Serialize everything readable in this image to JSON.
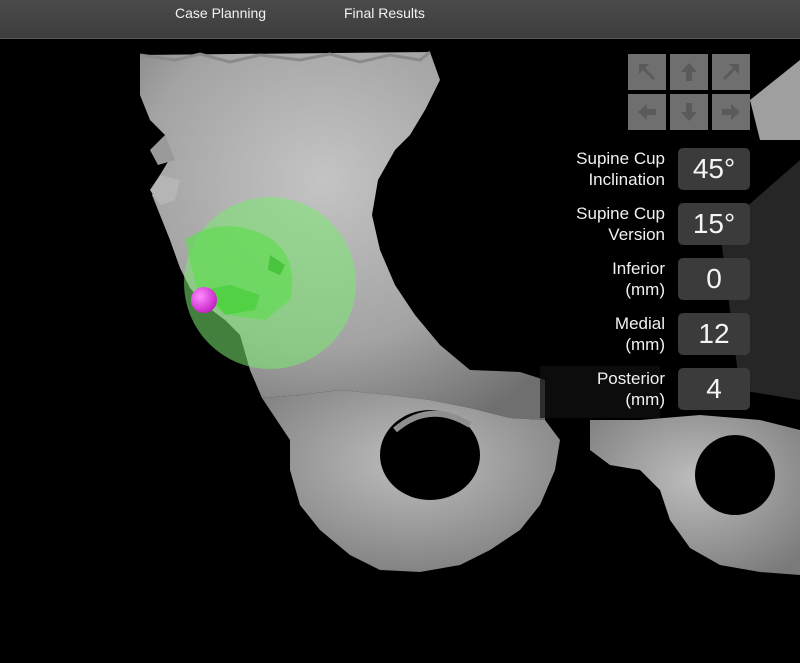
{
  "tabs": [
    "Case Planning",
    "Final Results"
  ],
  "nav": {
    "buttons": [
      "arrow-up-left",
      "arrow-up",
      "arrow-up-right",
      "arrow-left",
      "arrow-down",
      "arrow-right"
    ]
  },
  "params": [
    {
      "label_line1": "Supine Cup",
      "label_line2": "Inclination",
      "value": "45°"
    },
    {
      "label_line1": "Supine Cup",
      "label_line2": "Version",
      "value": "15°"
    },
    {
      "label_line1": "Inferior",
      "label_line2": "(mm)",
      "value": "0"
    },
    {
      "label_line1": "Medial",
      "label_line2": "(mm)",
      "value": "12"
    },
    {
      "label_line1": "Posterior",
      "label_line2": "(mm)",
      "value": "4"
    }
  ],
  "colors": {
    "bone": "#a8a8a8",
    "cup": "#7bea6f",
    "marker": "#e63ae6",
    "value_box": "#3b3b3b"
  }
}
